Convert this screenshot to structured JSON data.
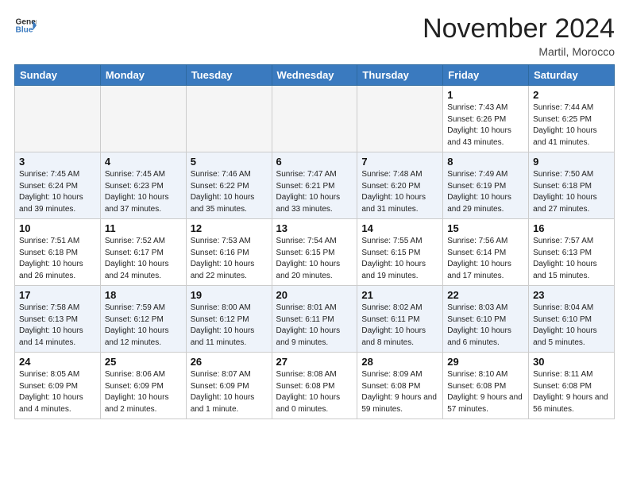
{
  "header": {
    "logo_line1": "General",
    "logo_line2": "Blue",
    "month": "November 2024",
    "location": "Martil, Morocco"
  },
  "weekdays": [
    "Sunday",
    "Monday",
    "Tuesday",
    "Wednesday",
    "Thursday",
    "Friday",
    "Saturday"
  ],
  "weeks": [
    [
      {
        "day": "",
        "empty": true
      },
      {
        "day": "",
        "empty": true
      },
      {
        "day": "",
        "empty": true
      },
      {
        "day": "",
        "empty": true
      },
      {
        "day": "",
        "empty": true
      },
      {
        "day": "1",
        "sunrise": "Sunrise: 7:43 AM",
        "sunset": "Sunset: 6:26 PM",
        "daylight": "Daylight: 10 hours and 43 minutes."
      },
      {
        "day": "2",
        "sunrise": "Sunrise: 7:44 AM",
        "sunset": "Sunset: 6:25 PM",
        "daylight": "Daylight: 10 hours and 41 minutes."
      }
    ],
    [
      {
        "day": "3",
        "sunrise": "Sunrise: 7:45 AM",
        "sunset": "Sunset: 6:24 PM",
        "daylight": "Daylight: 10 hours and 39 minutes."
      },
      {
        "day": "4",
        "sunrise": "Sunrise: 7:45 AM",
        "sunset": "Sunset: 6:23 PM",
        "daylight": "Daylight: 10 hours and 37 minutes."
      },
      {
        "day": "5",
        "sunrise": "Sunrise: 7:46 AM",
        "sunset": "Sunset: 6:22 PM",
        "daylight": "Daylight: 10 hours and 35 minutes."
      },
      {
        "day": "6",
        "sunrise": "Sunrise: 7:47 AM",
        "sunset": "Sunset: 6:21 PM",
        "daylight": "Daylight: 10 hours and 33 minutes."
      },
      {
        "day": "7",
        "sunrise": "Sunrise: 7:48 AM",
        "sunset": "Sunset: 6:20 PM",
        "daylight": "Daylight: 10 hours and 31 minutes."
      },
      {
        "day": "8",
        "sunrise": "Sunrise: 7:49 AM",
        "sunset": "Sunset: 6:19 PM",
        "daylight": "Daylight: 10 hours and 29 minutes."
      },
      {
        "day": "9",
        "sunrise": "Sunrise: 7:50 AM",
        "sunset": "Sunset: 6:18 PM",
        "daylight": "Daylight: 10 hours and 27 minutes."
      }
    ],
    [
      {
        "day": "10",
        "sunrise": "Sunrise: 7:51 AM",
        "sunset": "Sunset: 6:18 PM",
        "daylight": "Daylight: 10 hours and 26 minutes."
      },
      {
        "day": "11",
        "sunrise": "Sunrise: 7:52 AM",
        "sunset": "Sunset: 6:17 PM",
        "daylight": "Daylight: 10 hours and 24 minutes."
      },
      {
        "day": "12",
        "sunrise": "Sunrise: 7:53 AM",
        "sunset": "Sunset: 6:16 PM",
        "daylight": "Daylight: 10 hours and 22 minutes."
      },
      {
        "day": "13",
        "sunrise": "Sunrise: 7:54 AM",
        "sunset": "Sunset: 6:15 PM",
        "daylight": "Daylight: 10 hours and 20 minutes."
      },
      {
        "day": "14",
        "sunrise": "Sunrise: 7:55 AM",
        "sunset": "Sunset: 6:15 PM",
        "daylight": "Daylight: 10 hours and 19 minutes."
      },
      {
        "day": "15",
        "sunrise": "Sunrise: 7:56 AM",
        "sunset": "Sunset: 6:14 PM",
        "daylight": "Daylight: 10 hours and 17 minutes."
      },
      {
        "day": "16",
        "sunrise": "Sunrise: 7:57 AM",
        "sunset": "Sunset: 6:13 PM",
        "daylight": "Daylight: 10 hours and 15 minutes."
      }
    ],
    [
      {
        "day": "17",
        "sunrise": "Sunrise: 7:58 AM",
        "sunset": "Sunset: 6:13 PM",
        "daylight": "Daylight: 10 hours and 14 minutes."
      },
      {
        "day": "18",
        "sunrise": "Sunrise: 7:59 AM",
        "sunset": "Sunset: 6:12 PM",
        "daylight": "Daylight: 10 hours and 12 minutes."
      },
      {
        "day": "19",
        "sunrise": "Sunrise: 8:00 AM",
        "sunset": "Sunset: 6:12 PM",
        "daylight": "Daylight: 10 hours and 11 minutes."
      },
      {
        "day": "20",
        "sunrise": "Sunrise: 8:01 AM",
        "sunset": "Sunset: 6:11 PM",
        "daylight": "Daylight: 10 hours and 9 minutes."
      },
      {
        "day": "21",
        "sunrise": "Sunrise: 8:02 AM",
        "sunset": "Sunset: 6:11 PM",
        "daylight": "Daylight: 10 hours and 8 minutes."
      },
      {
        "day": "22",
        "sunrise": "Sunrise: 8:03 AM",
        "sunset": "Sunset: 6:10 PM",
        "daylight": "Daylight: 10 hours and 6 minutes."
      },
      {
        "day": "23",
        "sunrise": "Sunrise: 8:04 AM",
        "sunset": "Sunset: 6:10 PM",
        "daylight": "Daylight: 10 hours and 5 minutes."
      }
    ],
    [
      {
        "day": "24",
        "sunrise": "Sunrise: 8:05 AM",
        "sunset": "Sunset: 6:09 PM",
        "daylight": "Daylight: 10 hours and 4 minutes."
      },
      {
        "day": "25",
        "sunrise": "Sunrise: 8:06 AM",
        "sunset": "Sunset: 6:09 PM",
        "daylight": "Daylight: 10 hours and 2 minutes."
      },
      {
        "day": "26",
        "sunrise": "Sunrise: 8:07 AM",
        "sunset": "Sunset: 6:09 PM",
        "daylight": "Daylight: 10 hours and 1 minute."
      },
      {
        "day": "27",
        "sunrise": "Sunrise: 8:08 AM",
        "sunset": "Sunset: 6:08 PM",
        "daylight": "Daylight: 10 hours and 0 minutes."
      },
      {
        "day": "28",
        "sunrise": "Sunrise: 8:09 AM",
        "sunset": "Sunset: 6:08 PM",
        "daylight": "Daylight: 9 hours and 59 minutes."
      },
      {
        "day": "29",
        "sunrise": "Sunrise: 8:10 AM",
        "sunset": "Sunset: 6:08 PM",
        "daylight": "Daylight: 9 hours and 57 minutes."
      },
      {
        "day": "30",
        "sunrise": "Sunrise: 8:11 AM",
        "sunset": "Sunset: 6:08 PM",
        "daylight": "Daylight: 9 hours and 56 minutes."
      }
    ]
  ]
}
